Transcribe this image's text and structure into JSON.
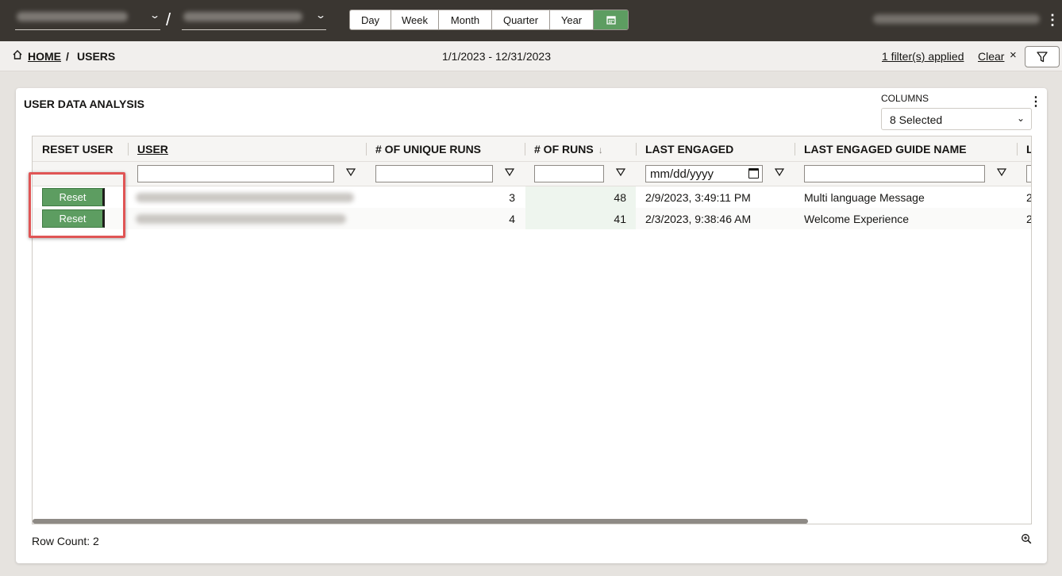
{
  "topbar": {
    "app_selector": {
      "value": ""
    },
    "guide_selector": {
      "value": ""
    },
    "separator": "/",
    "periods": [
      "Day",
      "Week",
      "Month",
      "Quarter",
      "Year"
    ],
    "calendar_icon": "calendar-icon",
    "more_icon": "kebab-icon"
  },
  "breadcrumb": {
    "home": "HOME",
    "separator": "/",
    "current": "USERS"
  },
  "date_range": "1/1/2023 - 12/31/2023",
  "filters": {
    "applied_label": "1 filter(s) applied",
    "clear_label": "Clear",
    "clear_icon": "×",
    "filter_icon": "funnel-icon"
  },
  "panel": {
    "title": "USER DATA ANALYSIS",
    "columns_label": "COLUMNS",
    "columns_value": "8 Selected",
    "columns_chevron": "⌄"
  },
  "table": {
    "headers": {
      "reset_user": "RESET USER",
      "user": "USER",
      "unique_runs": "# OF UNIQUE RUNS",
      "runs": "# OF RUNS",
      "runs_sort": "↓",
      "last_engaged": "LAST ENGAGED",
      "last_guide": "LAST ENGAGED GUIDE NAME",
      "overflow": "L"
    },
    "date_placeholder": "mm/dd/yyyy",
    "rows": [
      {
        "reset": "Reset",
        "unique_runs": "3",
        "runs": "48",
        "last_engaged": "2/9/2023, 3:49:11 PM",
        "guide": "Multi language Message",
        "overflow": "2"
      },
      {
        "reset": "Reset",
        "unique_runs": "4",
        "runs": "41",
        "last_engaged": "2/3/2023, 9:38:46 AM",
        "guide": "Welcome Experience",
        "overflow": "2"
      }
    ]
  },
  "footer": {
    "row_count": "Row Count: 2",
    "zoom_icon": "zoom-in-icon"
  },
  "colors": {
    "topbar": "#3a3631",
    "accent_green": "#5d9d61",
    "highlight_red": "#e05555"
  }
}
